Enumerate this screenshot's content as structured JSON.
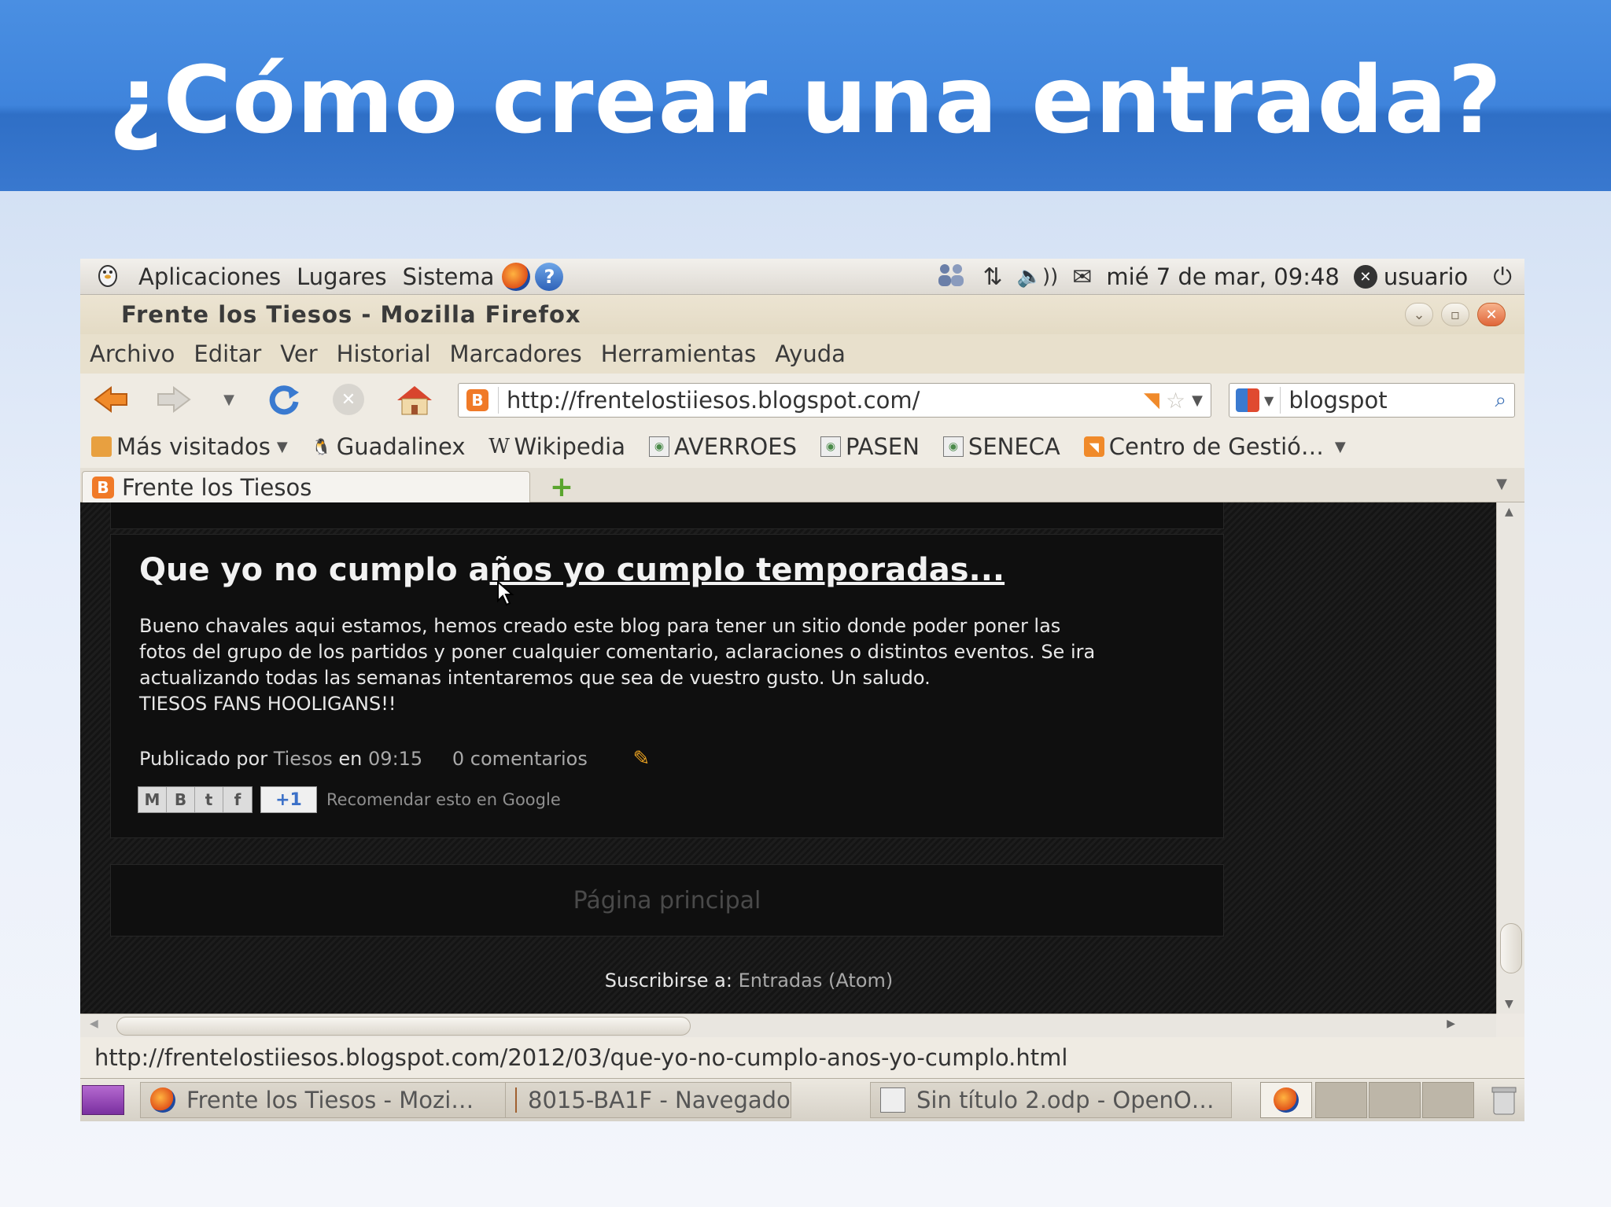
{
  "slide": {
    "title": "¿Cómo crear una entrada?"
  },
  "panel": {
    "menus": [
      "Aplicaciones",
      "Lugares",
      "Sistema"
    ],
    "datetime": "mié  7 de mar, 09:48",
    "user": "usuario"
  },
  "window": {
    "title": "Frente los Tiesos - Mozilla Firefox"
  },
  "menubar": [
    "Archivo",
    "Editar",
    "Ver",
    "Historial",
    "Marcadores",
    "Herramientas",
    "Ayuda"
  ],
  "navigation": {
    "url": "http://frentelostiiesos.blogspot.com/",
    "search_value": "blogspot"
  },
  "bookmarks": [
    "Más visitados",
    "Guadalinex",
    "Wikipedia",
    "AVERROES",
    "PASEN",
    "SENECA",
    "Centro de Gestió…"
  ],
  "tab": {
    "label": "Frente los Tiesos"
  },
  "post": {
    "title_plain": "Que yo no cumplo a",
    "title_link": "ños yo cumplo temporadas...",
    "body_lines": [
      "Bueno chavales aqui estamos, hemos creado este blog para tener un sitio donde poder poner las",
      "fotos del grupo de los partidos y poner cualquier comentario, aclaraciones o distintos eventos. Se ira",
      "actualizando todas las semanas intentaremos que sea de vuestro gusto. Un saludo.",
      "TIESOS FANS HOOLIGANS!!"
    ],
    "published_by": "Publicado por",
    "author": "Tiesos",
    "at": "en",
    "time": "09:15",
    "comments": "0 comentarios",
    "plus_one": "+1",
    "recommend": "Recomendar esto en Google"
  },
  "page_nav": {
    "home": "Página principal"
  },
  "subscribe": {
    "label": "Suscribirse a:",
    "link": "Entradas (Atom)"
  },
  "statusbar": {
    "url": "http://frentelostiiesos.blogspot.com/2012/03/que-yo-no-cumplo-anos-yo-cumplo.html"
  },
  "taskbar": {
    "tasks": [
      "Frente los Tiesos - Mozi…",
      "8015-BA1F - Navegado…",
      "Sin título 2.odp - OpenO…"
    ]
  },
  "colors": {
    "slide_header": "#3f84dc",
    "blog_background": "#141414",
    "blogger_orange": "#f07a28"
  }
}
